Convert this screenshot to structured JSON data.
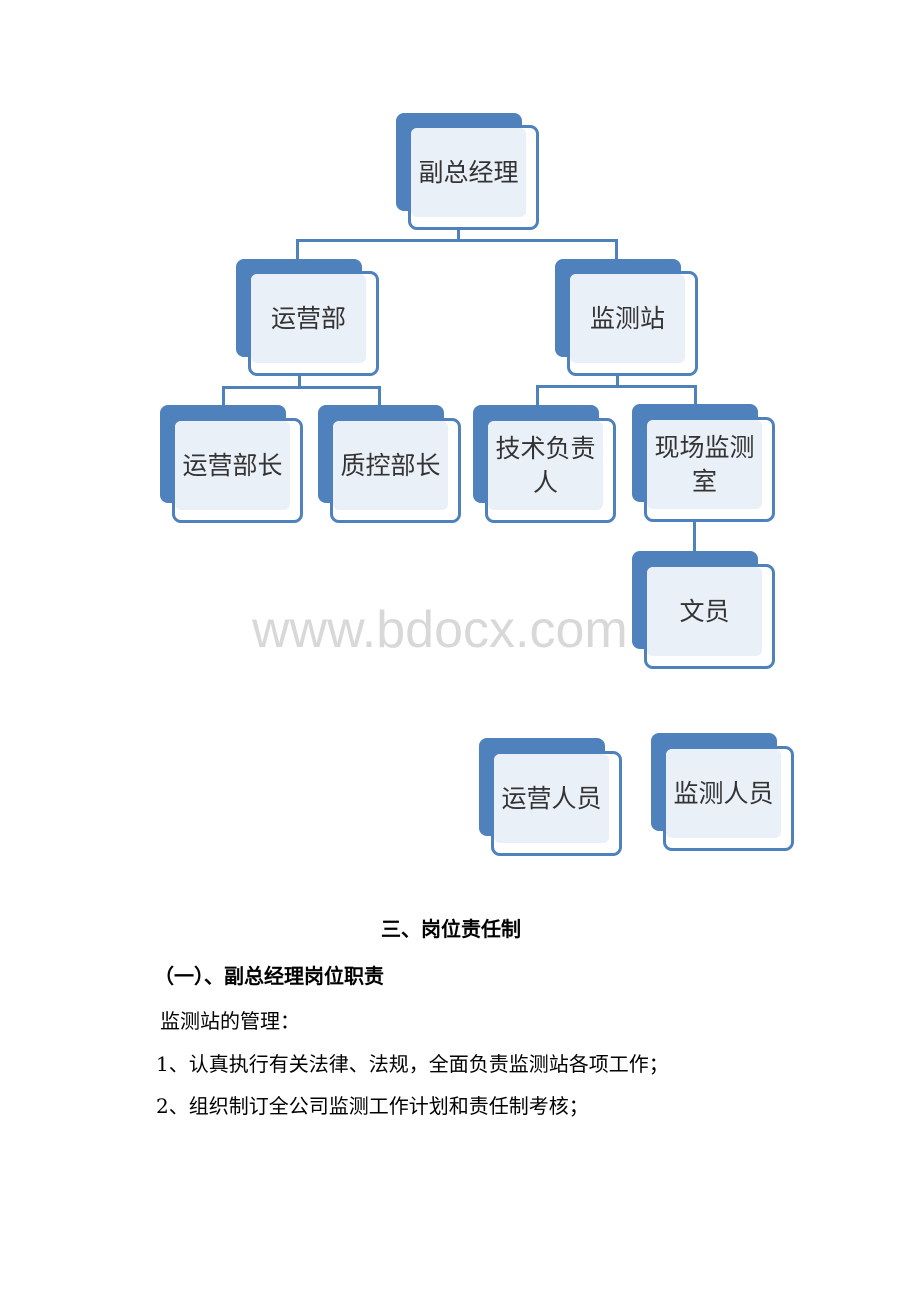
{
  "org_chart": {
    "nodes": {
      "deputy_gm": "副总经理",
      "operations_dept": "运营部",
      "monitoring_station": "监测站",
      "operations_head": "运营部长",
      "qc_head": "质控部长",
      "tech_lead": "技术负责人",
      "field_monitoring_room": "现场监测室",
      "clerk": "文员",
      "operations_staff": "运营人员",
      "monitoring_staff": "监测人员"
    },
    "colors": {
      "accent": "#4f81bd",
      "box_fill": "#eaf0f8"
    }
  },
  "watermark": "www.bdocx.com",
  "document": {
    "section_title": "三、岗位责任制",
    "subsection_title": "（一）、副总经理岗位职责",
    "intro": "监测站的管理：",
    "items": [
      "1、认真执行有关法律、法规，全面负责监测站各项工作；",
      "2、组织制订全公司监测工作计划和责任制考核；"
    ]
  }
}
